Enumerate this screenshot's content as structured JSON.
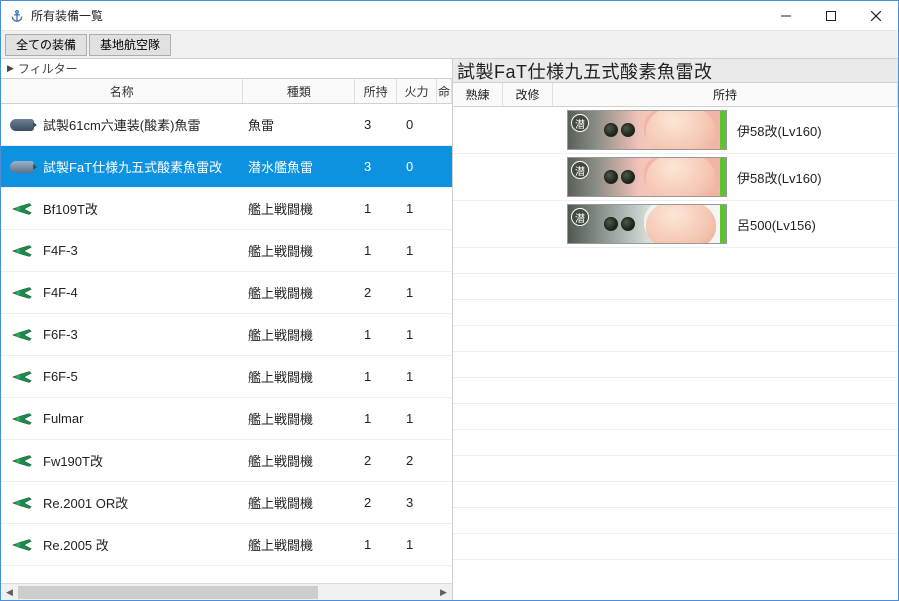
{
  "window": {
    "title": "所有装備一覧"
  },
  "toolbar": {
    "all": "全ての装備",
    "airbase": "基地航空隊"
  },
  "filter": {
    "label": "フィルター"
  },
  "grid": {
    "headers": {
      "name": "名称",
      "type": "種類",
      "owned": "所持",
      "fire": "火力",
      "extra": "命"
    },
    "rows": [
      {
        "icon": "torpedo",
        "name": "試製61cm六連装(酸素)魚雷",
        "type": "魚雷",
        "owned": "3",
        "fire": "0",
        "selected": false
      },
      {
        "icon": "torpedo",
        "name": "試製FaT仕様九五式酸素魚雷改",
        "type": "潜水艦魚雷",
        "owned": "3",
        "fire": "0",
        "selected": true
      },
      {
        "icon": "plane",
        "name": "Bf109T改",
        "type": "艦上戦闘機",
        "owned": "1",
        "fire": "1",
        "selected": false
      },
      {
        "icon": "plane",
        "name": "F4F-3",
        "type": "艦上戦闘機",
        "owned": "1",
        "fire": "1",
        "selected": false
      },
      {
        "icon": "plane",
        "name": "F4F-4",
        "type": "艦上戦闘機",
        "owned": "2",
        "fire": "1",
        "selected": false
      },
      {
        "icon": "plane",
        "name": "F6F-3",
        "type": "艦上戦闘機",
        "owned": "1",
        "fire": "1",
        "selected": false
      },
      {
        "icon": "plane",
        "name": "F6F-5",
        "type": "艦上戦闘機",
        "owned": "1",
        "fire": "1",
        "selected": false
      },
      {
        "icon": "plane",
        "name": "Fulmar",
        "type": "艦上戦闘機",
        "owned": "1",
        "fire": "1",
        "selected": false
      },
      {
        "icon": "plane",
        "name": "Fw190T改",
        "type": "艦上戦闘機",
        "owned": "2",
        "fire": "2",
        "selected": false
      },
      {
        "icon": "plane",
        "name": "Re.2001 OR改",
        "type": "艦上戦闘機",
        "owned": "2",
        "fire": "3",
        "selected": false
      },
      {
        "icon": "plane",
        "name": "Re.2005 改",
        "type": "艦上戦闘機",
        "owned": "1",
        "fire": "1",
        "selected": false
      }
    ]
  },
  "detail": {
    "title": "試製FaT仕様九五式酸素魚雷改",
    "headers": {
      "prof": "熟練",
      "imp": "改修",
      "owned": "所持"
    },
    "rows": [
      {
        "ship": "伊58改(Lv160)",
        "variant": "i58"
      },
      {
        "ship": "伊58改(Lv160)",
        "variant": "i58"
      },
      {
        "ship": "呂500(Lv156)",
        "variant": "ro"
      }
    ]
  }
}
